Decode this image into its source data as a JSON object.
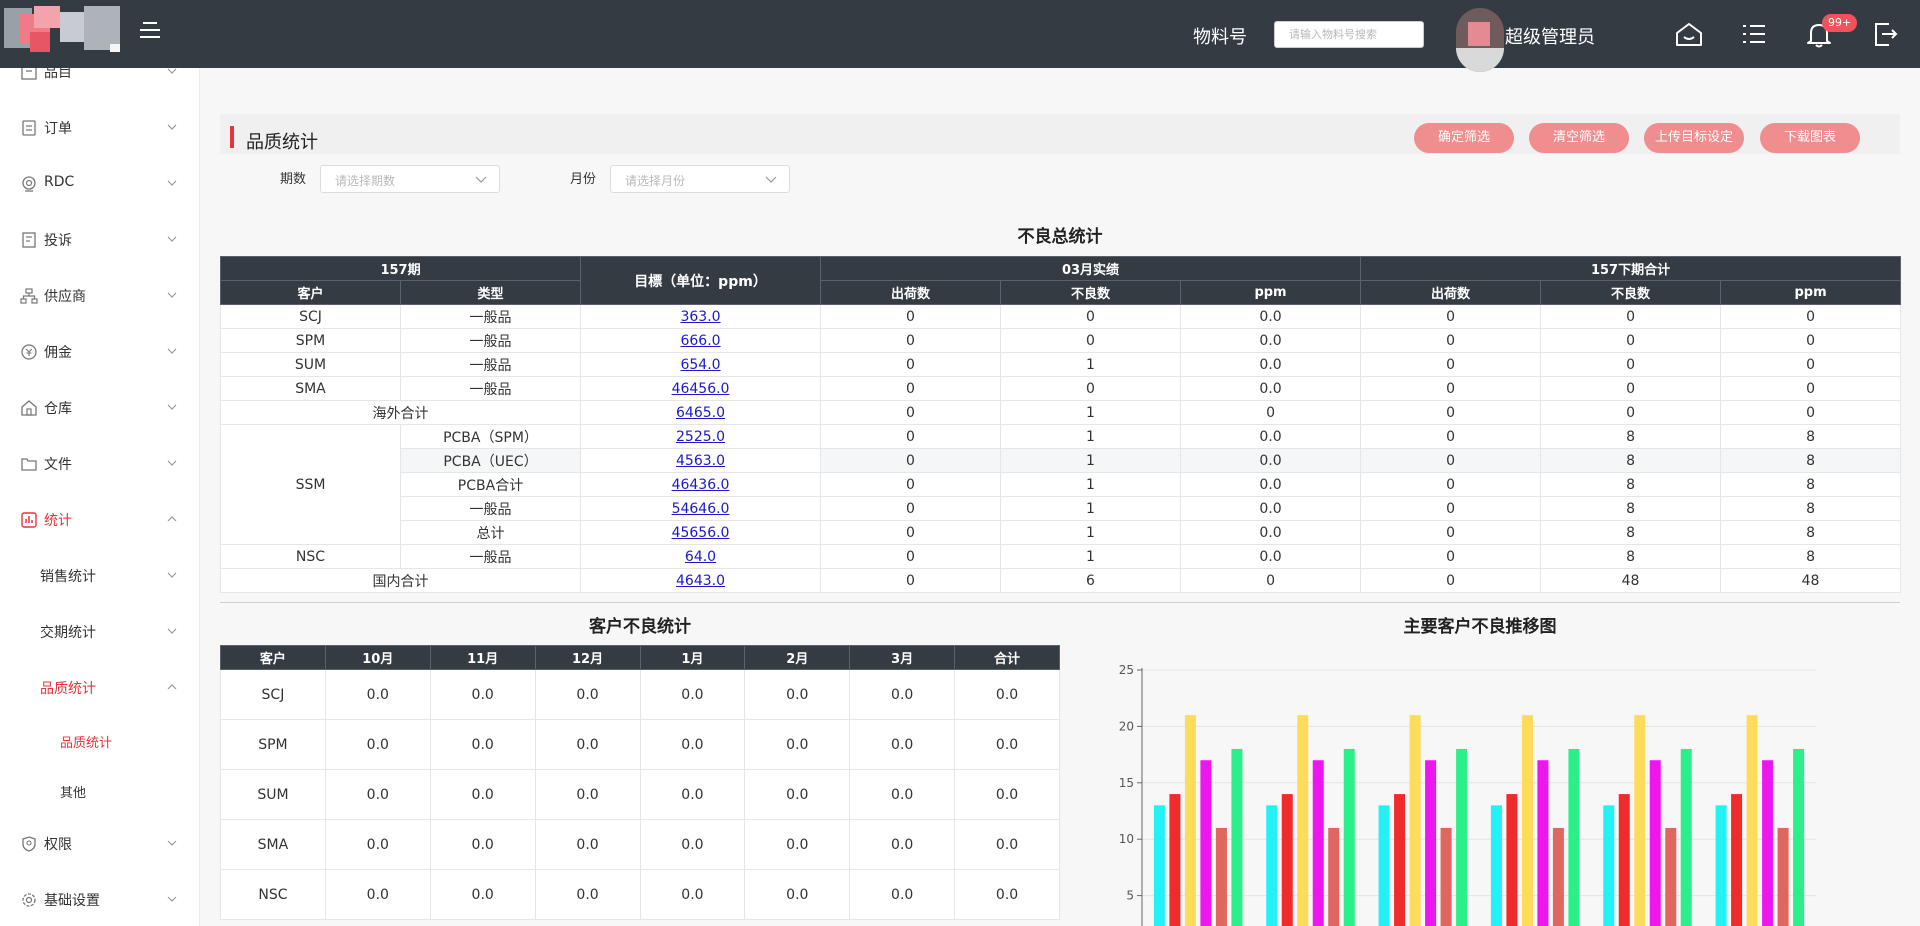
{
  "header": {
    "material_label": "物料号",
    "material_placeholder": "请输入物料号搜索",
    "user_name": "超级管理员",
    "notification_badge": "99+"
  },
  "sidebar": {
    "items": [
      {
        "label": "品目",
        "icon": "box-icon"
      },
      {
        "label": "订单",
        "icon": "order-icon"
      },
      {
        "label": "RDC",
        "icon": "camera-icon"
      },
      {
        "label": "投诉",
        "icon": "complaint-icon"
      },
      {
        "label": "供应商",
        "icon": "org-icon"
      },
      {
        "label": "佣金",
        "icon": "coin-icon"
      },
      {
        "label": "仓库",
        "icon": "warehouse-icon"
      },
      {
        "label": "文件",
        "icon": "folder-icon"
      },
      {
        "label": "统计",
        "icon": "chart-icon"
      },
      {
        "label": "销售统计"
      },
      {
        "label": "交期统计"
      },
      {
        "label": "品质统计"
      },
      {
        "label": "品质统计"
      },
      {
        "label": "其他"
      },
      {
        "label": "权限",
        "icon": "shield-icon"
      },
      {
        "label": "基础设置",
        "icon": "settings-icon"
      }
    ]
  },
  "page": {
    "title": "品质统计",
    "buttons": [
      "确定筛选",
      "清空筛选",
      "上传目标设定",
      "下载图表"
    ],
    "filter_period_label": "期数",
    "filter_period_placeholder": "请选择期数",
    "filter_month_label": "月份",
    "filter_month_placeholder": "请选择月份"
  },
  "summary": {
    "title": "不良总统计",
    "header_157": "157期",
    "header_target": "目標（单位：ppm）",
    "header_march": "03月实绩",
    "header_next": "157下期合计",
    "col_customer": "客户",
    "col_type": "类型",
    "col_ship": "出荷数",
    "col_defect": "不良数",
    "col_ppm": "ppm",
    "rows": [
      {
        "customer": "SCJ",
        "type": "一般品",
        "target": "363.0",
        "v": [
          "0",
          "0",
          "0.0",
          "0",
          "0",
          "0"
        ]
      },
      {
        "customer": "SPM",
        "type": "一般品",
        "target": "666.0",
        "v": [
          "0",
          "0",
          "0.0",
          "0",
          "0",
          "0"
        ]
      },
      {
        "customer": "SUM",
        "type": "一般品",
        "target": "654.0",
        "v": [
          "0",
          "1",
          "0.0",
          "0",
          "0",
          "0"
        ]
      },
      {
        "customer": "SMA",
        "type": "一般品",
        "target": "46456.0",
        "v": [
          "0",
          "0",
          "0.0",
          "0",
          "0",
          "0"
        ]
      },
      {
        "merged": "海外合计",
        "target": "6465.0",
        "v": [
          "0",
          "1",
          "0",
          "0",
          "0",
          "0"
        ]
      },
      {
        "customer": "SSM",
        "type": "PCBA（SPM）",
        "target": "2525.0",
        "v": [
          "0",
          "1",
          "0.0",
          "0",
          "8",
          "8"
        ]
      },
      {
        "type": "PCBA（UEC）",
        "target": "4563.0",
        "v": [
          "0",
          "1",
          "0.0",
          "0",
          "8",
          "8"
        ]
      },
      {
        "type": "PCBA合计",
        "target": "46436.0",
        "v": [
          "0",
          "1",
          "0.0",
          "0",
          "8",
          "8"
        ]
      },
      {
        "type": "一般品",
        "target": "54646.0",
        "v": [
          "0",
          "1",
          "0.0",
          "0",
          "8",
          "8"
        ]
      },
      {
        "type": "总计",
        "target": "45656.0",
        "v": [
          "0",
          "1",
          "0.0",
          "0",
          "8",
          "8"
        ]
      },
      {
        "customer": "NSC",
        "type": "一般品",
        "target": "64.0",
        "v": [
          "0",
          "1",
          "0.0",
          "0",
          "8",
          "8"
        ]
      },
      {
        "merged": "国内合计",
        "target": "4643.0",
        "v": [
          "0",
          "6",
          "0",
          "0",
          "48",
          "48"
        ]
      }
    ]
  },
  "customer_defects": {
    "title": "客户不良统计",
    "headers": [
      "客户",
      "10月",
      "11月",
      "12月",
      "1月",
      "2月",
      "3月",
      "合计"
    ],
    "rows": [
      [
        "SCJ",
        "0.0",
        "0.0",
        "0.0",
        "0.0",
        "0.0",
        "0.0",
        "0.0"
      ],
      [
        "SPM",
        "0.0",
        "0.0",
        "0.0",
        "0.0",
        "0.0",
        "0.0",
        "0.0"
      ],
      [
        "SUM",
        "0.0",
        "0.0",
        "0.0",
        "0.0",
        "0.0",
        "0.0",
        "0.0"
      ],
      [
        "SMA",
        "0.0",
        "0.0",
        "0.0",
        "0.0",
        "0.0",
        "0.0",
        "0.0"
      ],
      [
        "NSC",
        "0.0",
        "0.0",
        "0.0",
        "0.0",
        "0.0",
        "0.0",
        "0.0"
      ]
    ]
  },
  "colors": {
    "header_bg": "#353b43",
    "accent_red": "#e8333a",
    "pill_bg": "#f08d8f",
    "link_blue": "#1a1acc"
  },
  "chart_data": {
    "type": "bar",
    "title": "主要客户不良推移图",
    "ylim": [
      0,
      25
    ],
    "yticks": [
      5,
      10,
      15,
      20,
      25
    ],
    "group_count": 6,
    "series_colors": [
      "#22f2f5",
      "#ef2b2b",
      "#fddc5a",
      "#ee16ee",
      "#e0675f",
      "#2bf08a"
    ],
    "series": [
      {
        "values": [
          13,
          13,
          13,
          13,
          13,
          13
        ]
      },
      {
        "values": [
          14,
          14,
          14,
          14,
          14,
          14
        ]
      },
      {
        "values": [
          21,
          21,
          21,
          21,
          21,
          21
        ]
      },
      {
        "values": [
          17,
          17,
          17,
          17,
          17,
          17
        ]
      },
      {
        "values": [
          11,
          11,
          11,
          11,
          11,
          11
        ]
      },
      {
        "values": [
          18,
          18,
          18,
          18,
          18,
          18
        ]
      }
    ]
  }
}
